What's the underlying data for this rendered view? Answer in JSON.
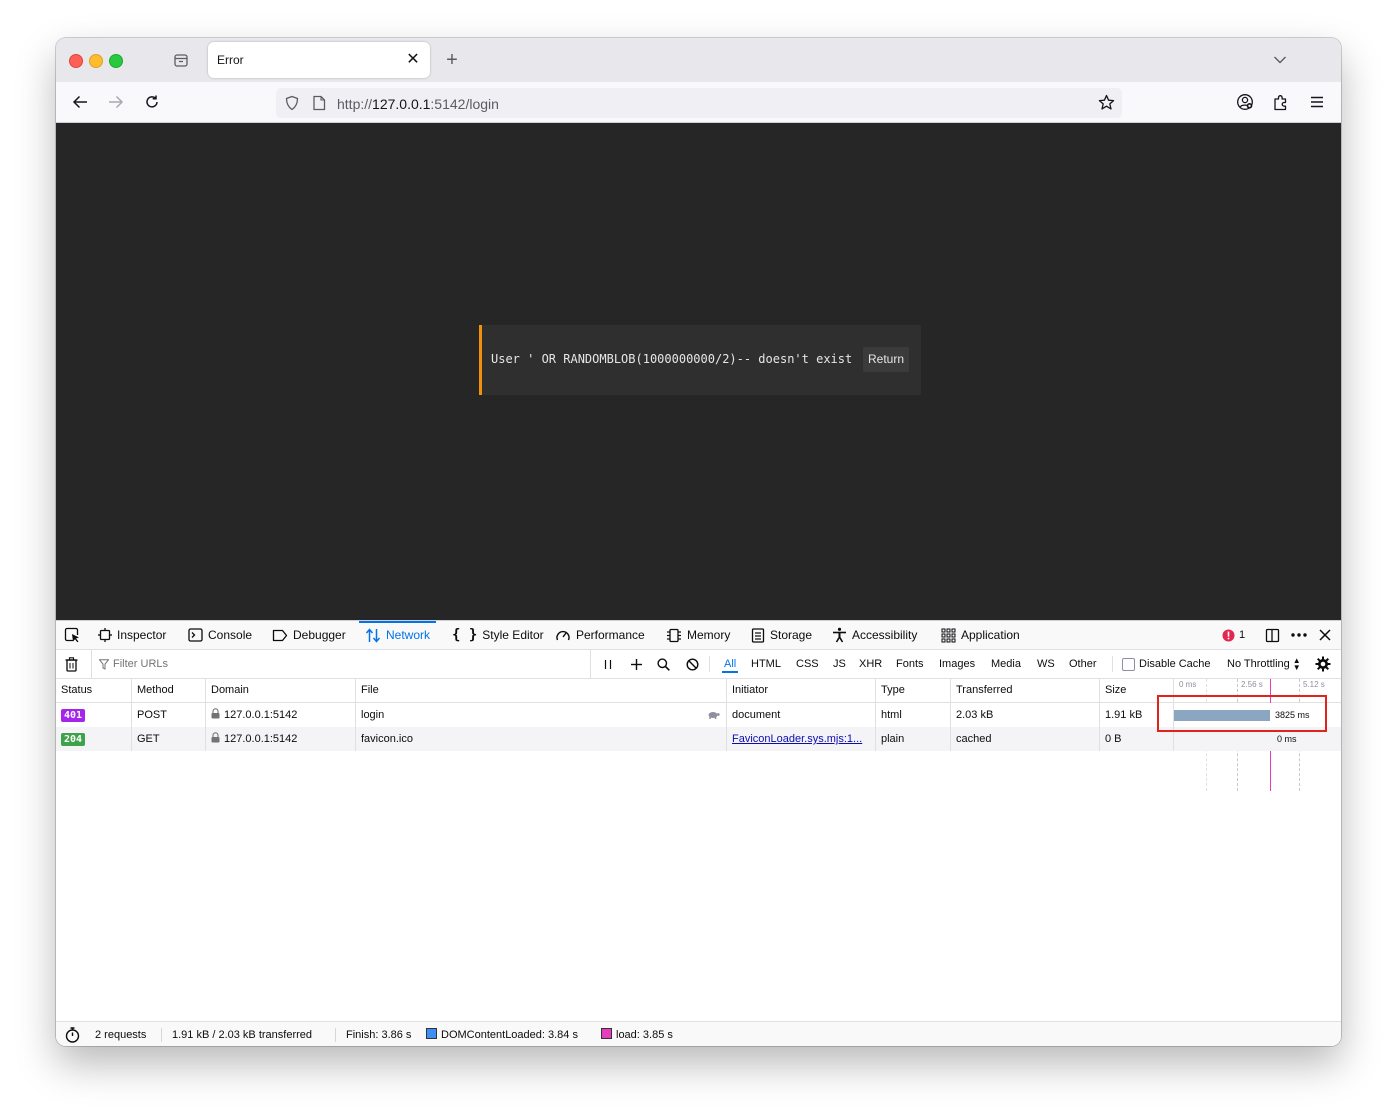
{
  "browser": {
    "tab_title": "Error",
    "url_prefix": "http://",
    "url_host": "127.0.0.1",
    "url_rest": ":5142/login"
  },
  "page": {
    "message": "User ' OR RANDOMBLOB(1000000000/2)-- doesn't exist",
    "return_label": "Return",
    "accent_color": "#f0900b"
  },
  "devtools": {
    "tabs": {
      "inspector": "Inspector",
      "console": "Console",
      "debugger": "Debugger",
      "network": "Network",
      "style_editor": "Style Editor",
      "performance": "Performance",
      "memory": "Memory",
      "storage": "Storage",
      "accessibility": "Accessibility",
      "application": "Application"
    },
    "error_count": "1",
    "filter_placeholder": "Filter URLs",
    "types": [
      "All",
      "HTML",
      "CSS",
      "JS",
      "XHR",
      "Fonts",
      "Images",
      "Media",
      "WS",
      "Other"
    ],
    "disable_cache": "Disable Cache",
    "throttling": "No Throttling",
    "columns": {
      "status": "Status",
      "method": "Method",
      "domain": "Domain",
      "file": "File",
      "initiator": "Initiator",
      "type": "Type",
      "transferred": "Transferred",
      "size": "Size"
    },
    "waterfall_ticks": [
      "0 ms",
      "2.56 s",
      "5.12 s"
    ],
    "requests": [
      {
        "status": "401",
        "status_color": "#a625ec",
        "method": "POST",
        "domain": "127.0.0.1:5142",
        "file": "login",
        "initiator": "document",
        "type": "html",
        "transferred": "2.03 kB",
        "size": "1.91 kB",
        "timing": "3825 ms"
      },
      {
        "status": "204",
        "status_color": "#3da34a",
        "method": "GET",
        "domain": "127.0.0.1:5142",
        "file": "favicon.ico",
        "initiator": "FaviconLoader.sys.mjs:1...",
        "type": "plain",
        "transferred": "cached",
        "size": "0 B",
        "timing": "0 ms"
      }
    ],
    "status_bar": {
      "requests": "2 requests",
      "transferred": "1.91 kB / 2.03 kB transferred",
      "finish": "Finish: 3.86 s",
      "dom_content_loaded": "DOMContentLoaded: 3.84 s",
      "load": "load: 3.85 s"
    },
    "highlight_color": "#e0231b"
  }
}
